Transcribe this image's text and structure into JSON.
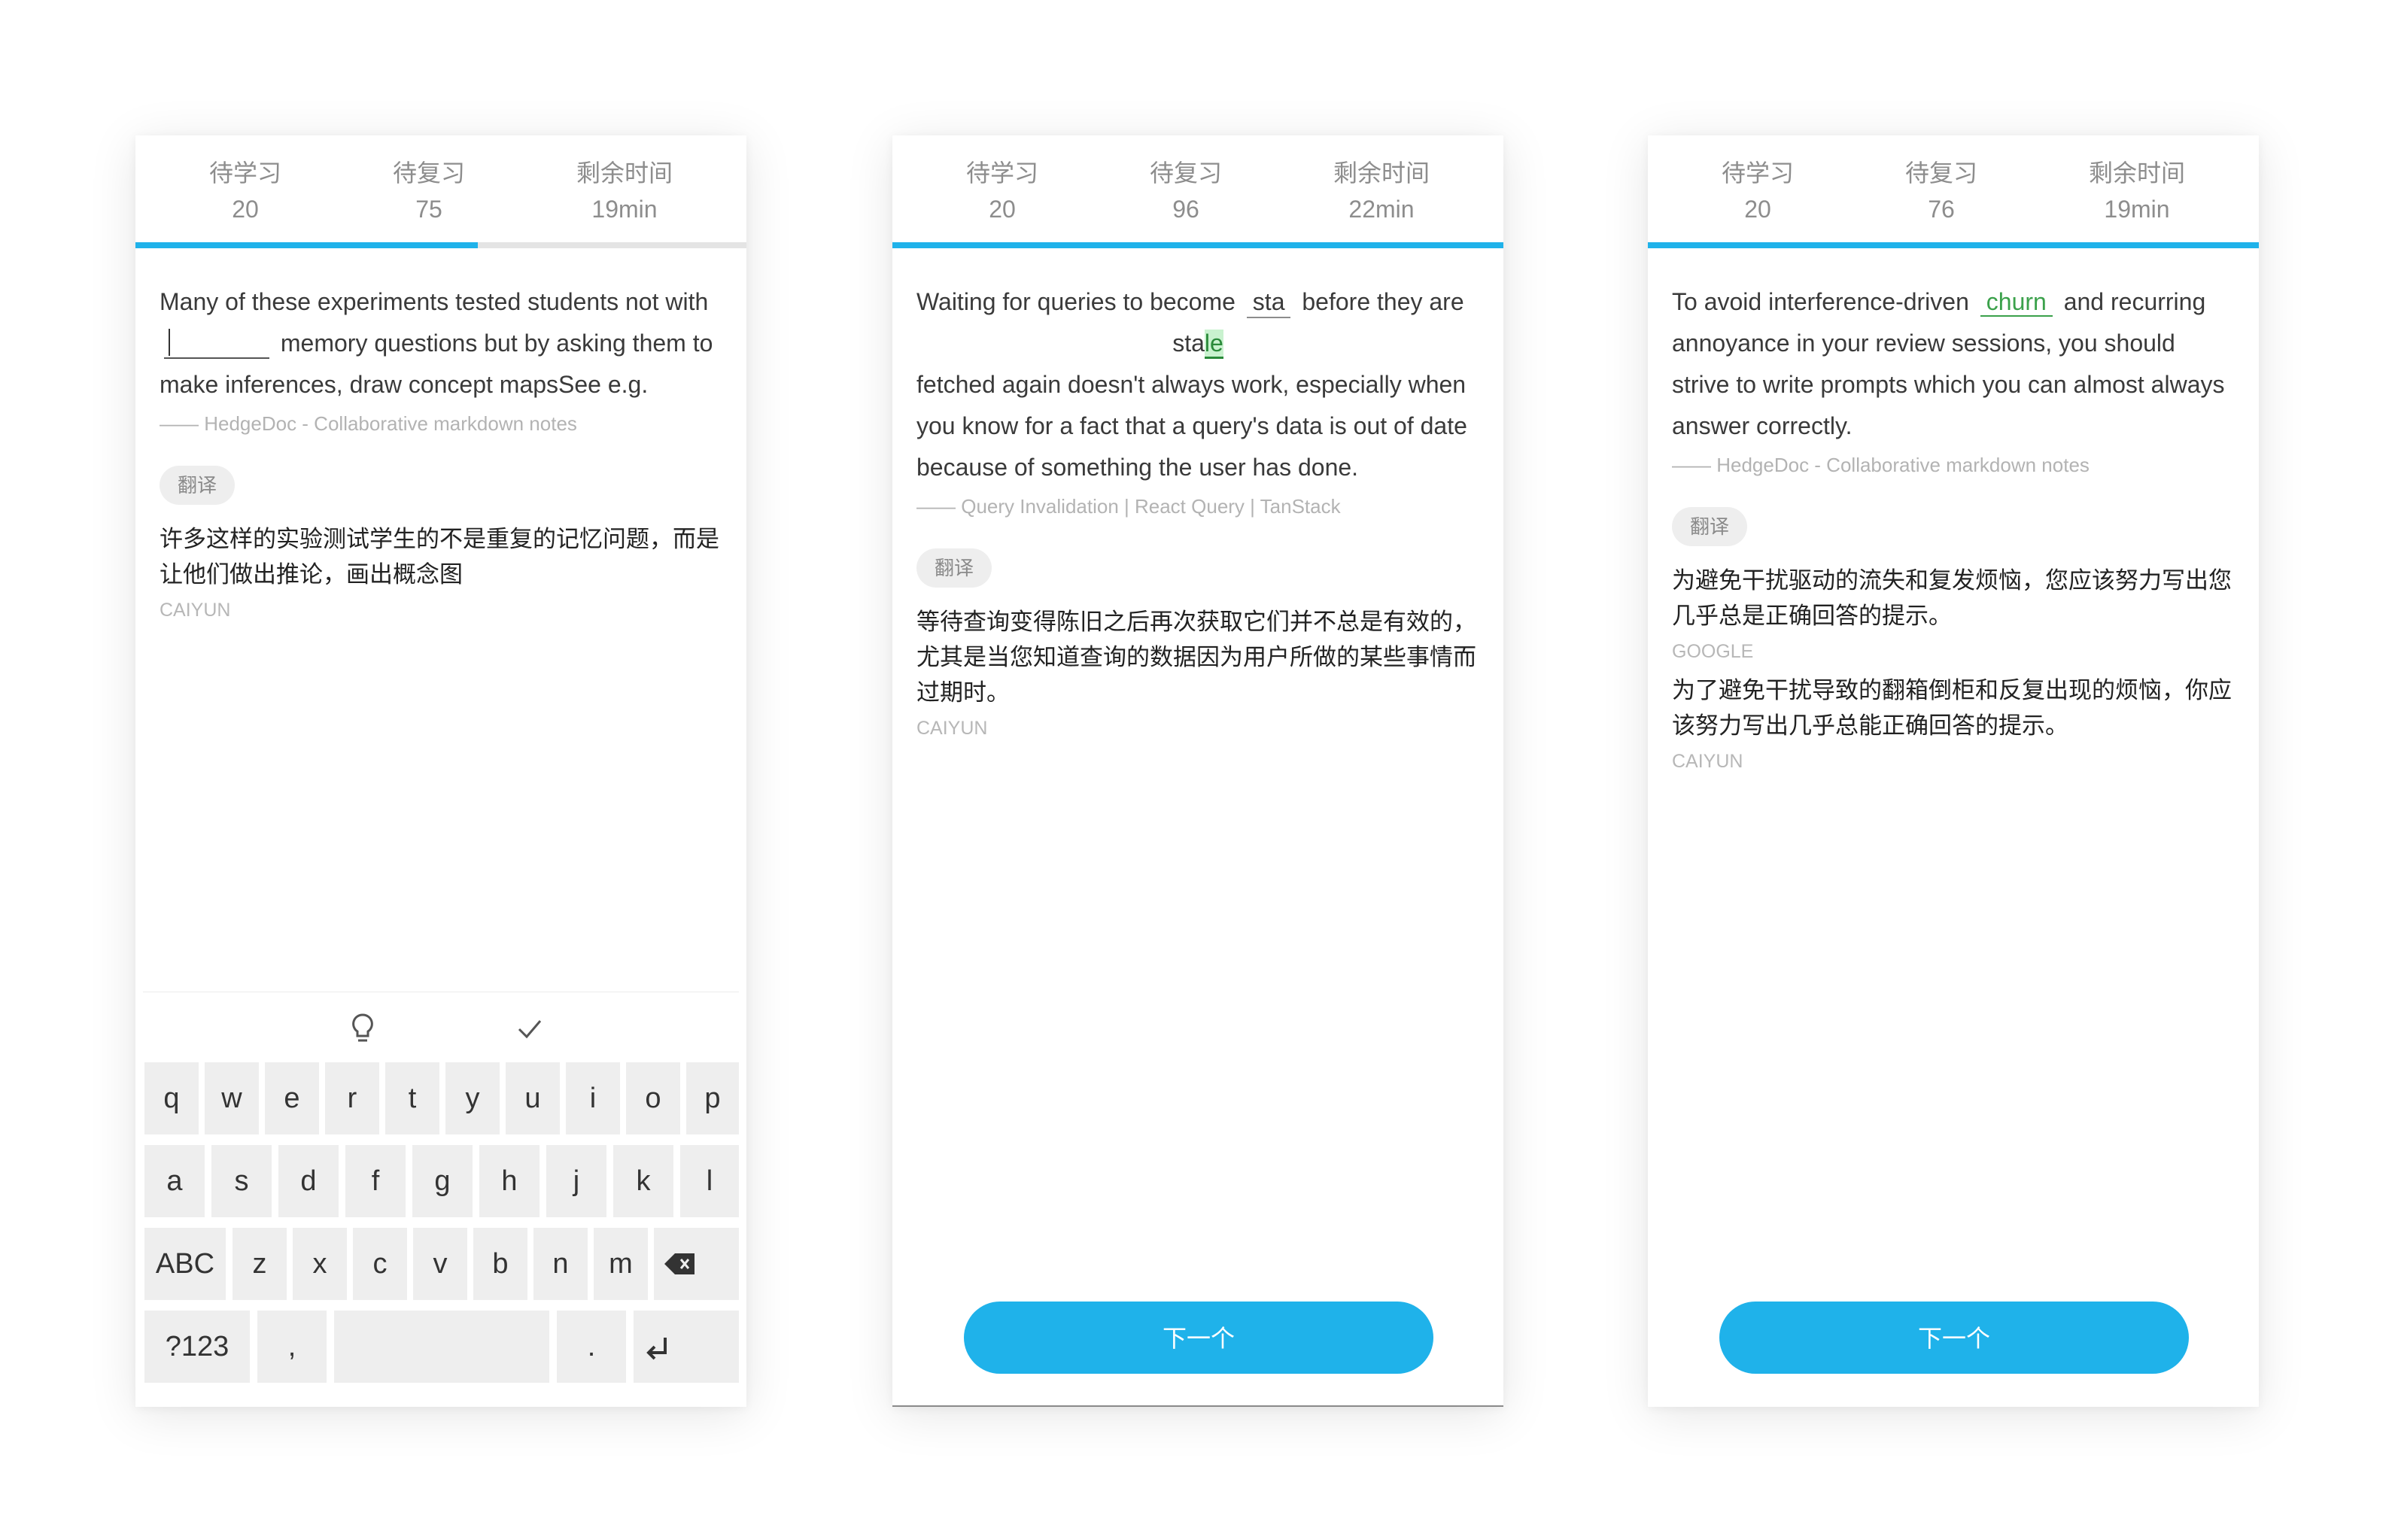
{
  "screens": [
    {
      "stats": [
        {
          "label": "待学习",
          "value": "20"
        },
        {
          "label": "待复习",
          "value": "75"
        },
        {
          "label": "剩余时间",
          "value": "19min"
        }
      ],
      "progress": 0.56,
      "sentence_before": "Many of these experiments tested students not with",
      "sentence_after": "memory questions but by asking them to make inferences, draw concept mapsSee e.g.",
      "source": "—— HedgeDoc - Collaborative markdown notes",
      "translate_label": "翻译",
      "translations": [
        {
          "text": "许多这样的实验测试学生的不是重复的记忆问题，而是让他们做出推论，画出概念图",
          "provider": "CAIYUN"
        }
      ],
      "toolbar": {
        "hint_icon": "lightbulb-icon",
        "check_icon": "check-icon"
      },
      "keyboard": {
        "row1": [
          "q",
          "w",
          "e",
          "r",
          "t",
          "y",
          "u",
          "i",
          "o",
          "p"
        ],
        "row2": [
          "a",
          "s",
          "d",
          "f",
          "g",
          "h",
          "j",
          "k",
          "l"
        ],
        "row3": [
          "ABC",
          "z",
          "x",
          "c",
          "v",
          "b",
          "n",
          "m"
        ],
        "row4_left": "?123",
        "row4_comma": ",",
        "row4_period": "."
      }
    },
    {
      "stats": [
        {
          "label": "待学习",
          "value": "20"
        },
        {
          "label": "待复习",
          "value": "96"
        },
        {
          "label": "剩余时间",
          "value": "22min"
        }
      ],
      "progress": 1.0,
      "sentence_before": "Waiting for queries to become",
      "typed_word": "sta",
      "sentence_mid": "before they are",
      "answer_prefix": "sta",
      "answer_highlight": "le",
      "sentence_after": "fetched again doesn't always work, especially when you know for a fact that a query's data is out of date because of something the user has done.",
      "source": "—— Query Invalidation | React Query | TanStack",
      "translate_label": "翻译",
      "translations": [
        {
          "text": "等待查询变得陈旧之后再次获取它们并不总是有效的，尤其是当您知道查询的数据因为用户所做的某些事情而过期时。",
          "provider": "CAIYUN"
        }
      ],
      "next_label": "下一个"
    },
    {
      "stats": [
        {
          "label": "待学习",
          "value": "20"
        },
        {
          "label": "待复习",
          "value": "76"
        },
        {
          "label": "剩余时间",
          "value": "19min"
        }
      ],
      "progress": 1.0,
      "sentence_before": "To avoid interference-driven",
      "answer_word": "churn",
      "sentence_after": "and recurring annoyance in your review sessions, you should strive to write prompts which you can almost always an­swer correctly.",
      "source": "—— HedgeDoc - Collaborative markdown notes",
      "translate_label": "翻译",
      "translations": [
        {
          "text": "为避免干扰驱动的流失和复发烦恼，您应该努力写出您几乎总是正确回答的提示。",
          "provider": "GOOGLE"
        },
        {
          "text": "为了避免干扰导致的翻箱倒柜和反复出现的烦恼，你应该努力写出几乎总能正确回答的提示。",
          "provider": "CAIYUN"
        }
      ],
      "next_label": "下一个"
    }
  ],
  "colors": {
    "accent": "#1fb2ea",
    "correct": "#3ba14b",
    "muted": "#b3b3b3"
  }
}
